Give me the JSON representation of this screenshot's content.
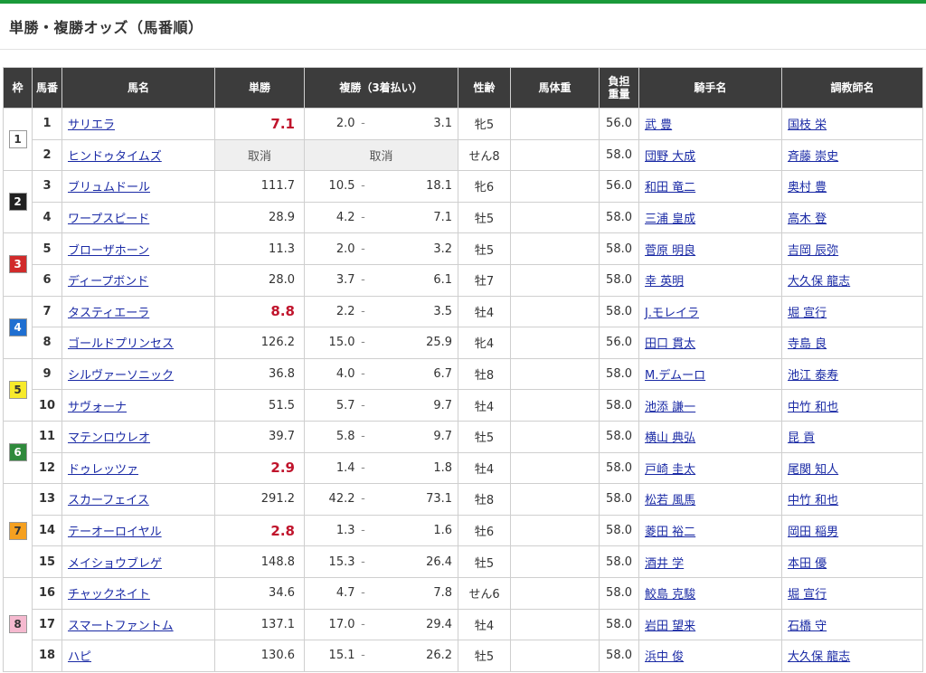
{
  "page": {
    "title": "単勝・複勝オッズ（馬番順）"
  },
  "headers": {
    "waku": "枠",
    "umaban": "馬番",
    "horse": "馬名",
    "win": "単勝",
    "place": "複勝（3着払い）",
    "sexage": "性齢",
    "body_weight": "馬体重",
    "burden": "負担重量",
    "jockey": "騎手名",
    "trainer": "調教師名"
  },
  "place_sep": "-",
  "waku_colors": {
    "1": {
      "bg": "#ffffff",
      "fg": "#333333"
    },
    "2": {
      "bg": "#222222",
      "fg": "#ffffff"
    },
    "3": {
      "bg": "#d12b2b",
      "fg": "#ffffff"
    },
    "4": {
      "bg": "#1f6fd1",
      "fg": "#ffffff"
    },
    "5": {
      "bg": "#f7ea2b",
      "fg": "#333333"
    },
    "6": {
      "bg": "#2f8a3c",
      "fg": "#ffffff"
    },
    "7": {
      "bg": "#f5a020",
      "fg": "#333333"
    },
    "8": {
      "bg": "#f5b9cf",
      "fg": "#333333"
    }
  },
  "rows": [
    {
      "waku": "1",
      "num": "1",
      "horse": "サリエラ",
      "win": "7.1",
      "hot": true,
      "pmin": "2.0",
      "pmax": "3.1",
      "sex": "牝5",
      "body": "",
      "weight": "56.0",
      "jockey": "武 豊",
      "trainer": "国枝 栄"
    },
    {
      "waku": "1",
      "num": "2",
      "horse": "ヒンドゥタイムズ",
      "scratched": true,
      "win": "取消",
      "place": "取消",
      "sex": "せん8",
      "body": "",
      "weight": "58.0",
      "jockey": "団野 大成",
      "trainer": "斉藤 崇史"
    },
    {
      "waku": "2",
      "num": "3",
      "horse": "ブリュムドール",
      "win": "111.7",
      "pmin": "10.5",
      "pmax": "18.1",
      "sex": "牝6",
      "body": "",
      "weight": "56.0",
      "jockey": "和田 竜二",
      "trainer": "奥村 豊"
    },
    {
      "waku": "2",
      "num": "4",
      "horse": "ワープスピード",
      "win": "28.9",
      "pmin": "4.2",
      "pmax": "7.1",
      "sex": "牡5",
      "body": "",
      "weight": "58.0",
      "jockey": "三浦 皇成",
      "trainer": "高木 登"
    },
    {
      "waku": "3",
      "num": "5",
      "horse": "ブローザホーン",
      "win": "11.3",
      "pmin": "2.0",
      "pmax": "3.2",
      "sex": "牡5",
      "body": "",
      "weight": "58.0",
      "jockey": "菅原 明良",
      "trainer": "吉岡 辰弥"
    },
    {
      "waku": "3",
      "num": "6",
      "horse": "ディープボンド",
      "win": "28.0",
      "pmin": "3.7",
      "pmax": "6.1",
      "sex": "牡7",
      "body": "",
      "weight": "58.0",
      "jockey": "幸 英明",
      "trainer": "大久保 龍志"
    },
    {
      "waku": "4",
      "num": "7",
      "horse": "タスティエーラ",
      "win": "8.8",
      "hot": true,
      "pmin": "2.2",
      "pmax": "3.5",
      "sex": "牡4",
      "body": "",
      "weight": "58.0",
      "jockey": "J.モレイラ",
      "trainer": "堀 宣行"
    },
    {
      "waku": "4",
      "num": "8",
      "horse": "ゴールドプリンセス",
      "win": "126.2",
      "pmin": "15.0",
      "pmax": "25.9",
      "sex": "牝4",
      "body": "",
      "weight": "56.0",
      "jockey": "田口 貫太",
      "trainer": "寺島 良"
    },
    {
      "waku": "5",
      "num": "9",
      "horse": "シルヴァーソニック",
      "win": "36.8",
      "pmin": "4.0",
      "pmax": "6.7",
      "sex": "牡8",
      "body": "",
      "weight": "58.0",
      "jockey": "M.デムーロ",
      "trainer": "池江 泰寿"
    },
    {
      "waku": "5",
      "num": "10",
      "horse": "サヴォーナ",
      "win": "51.5",
      "pmin": "5.7",
      "pmax": "9.7",
      "sex": "牡4",
      "body": "",
      "weight": "58.0",
      "jockey": "池添 謙一",
      "trainer": "中竹 和也"
    },
    {
      "waku": "6",
      "num": "11",
      "horse": "マテンロウレオ",
      "win": "39.7",
      "pmin": "5.8",
      "pmax": "9.7",
      "sex": "牡5",
      "body": "",
      "weight": "58.0",
      "jockey": "横山 典弘",
      "trainer": "昆 貢"
    },
    {
      "waku": "6",
      "num": "12",
      "horse": "ドゥレッツァ",
      "win": "2.9",
      "hot": true,
      "pmin": "1.4",
      "pmax": "1.8",
      "sex": "牡4",
      "body": "",
      "weight": "58.0",
      "jockey": "戸崎 圭太",
      "trainer": "尾関 知人"
    },
    {
      "waku": "7",
      "num": "13",
      "horse": "スカーフェイス",
      "win": "291.2",
      "pmin": "42.2",
      "pmax": "73.1",
      "sex": "牡8",
      "body": "",
      "weight": "58.0",
      "jockey": "松若 風馬",
      "trainer": "中竹 和也"
    },
    {
      "waku": "7",
      "num": "14",
      "horse": "テーオーロイヤル",
      "win": "2.8",
      "hot": true,
      "pmin": "1.3",
      "pmax": "1.6",
      "sex": "牡6",
      "body": "",
      "weight": "58.0",
      "jockey": "菱田 裕二",
      "trainer": "岡田 稲男"
    },
    {
      "waku": "7",
      "num": "15",
      "horse": "メイショウブレゲ",
      "win": "148.8",
      "pmin": "15.3",
      "pmax": "26.4",
      "sex": "牡5",
      "body": "",
      "weight": "58.0",
      "jockey": "酒井 学",
      "trainer": "本田 優"
    },
    {
      "waku": "8",
      "num": "16",
      "horse": "チャックネイト",
      "win": "34.6",
      "pmin": "4.7",
      "pmax": "7.8",
      "sex": "せん6",
      "body": "",
      "weight": "58.0",
      "jockey": "鮫島 克駿",
      "trainer": "堀 宣行"
    },
    {
      "waku": "8",
      "num": "17",
      "horse": "スマートファントム",
      "win": "137.1",
      "pmin": "17.0",
      "pmax": "29.4",
      "sex": "牡4",
      "body": "",
      "weight": "58.0",
      "jockey": "岩田 望来",
      "trainer": "石橋 守"
    },
    {
      "waku": "8",
      "num": "18",
      "horse": "ハピ",
      "win": "130.6",
      "pmin": "15.1",
      "pmax": "26.2",
      "sex": "牡5",
      "body": "",
      "weight": "58.0",
      "jockey": "浜中 俊",
      "trainer": "大久保 龍志"
    }
  ]
}
